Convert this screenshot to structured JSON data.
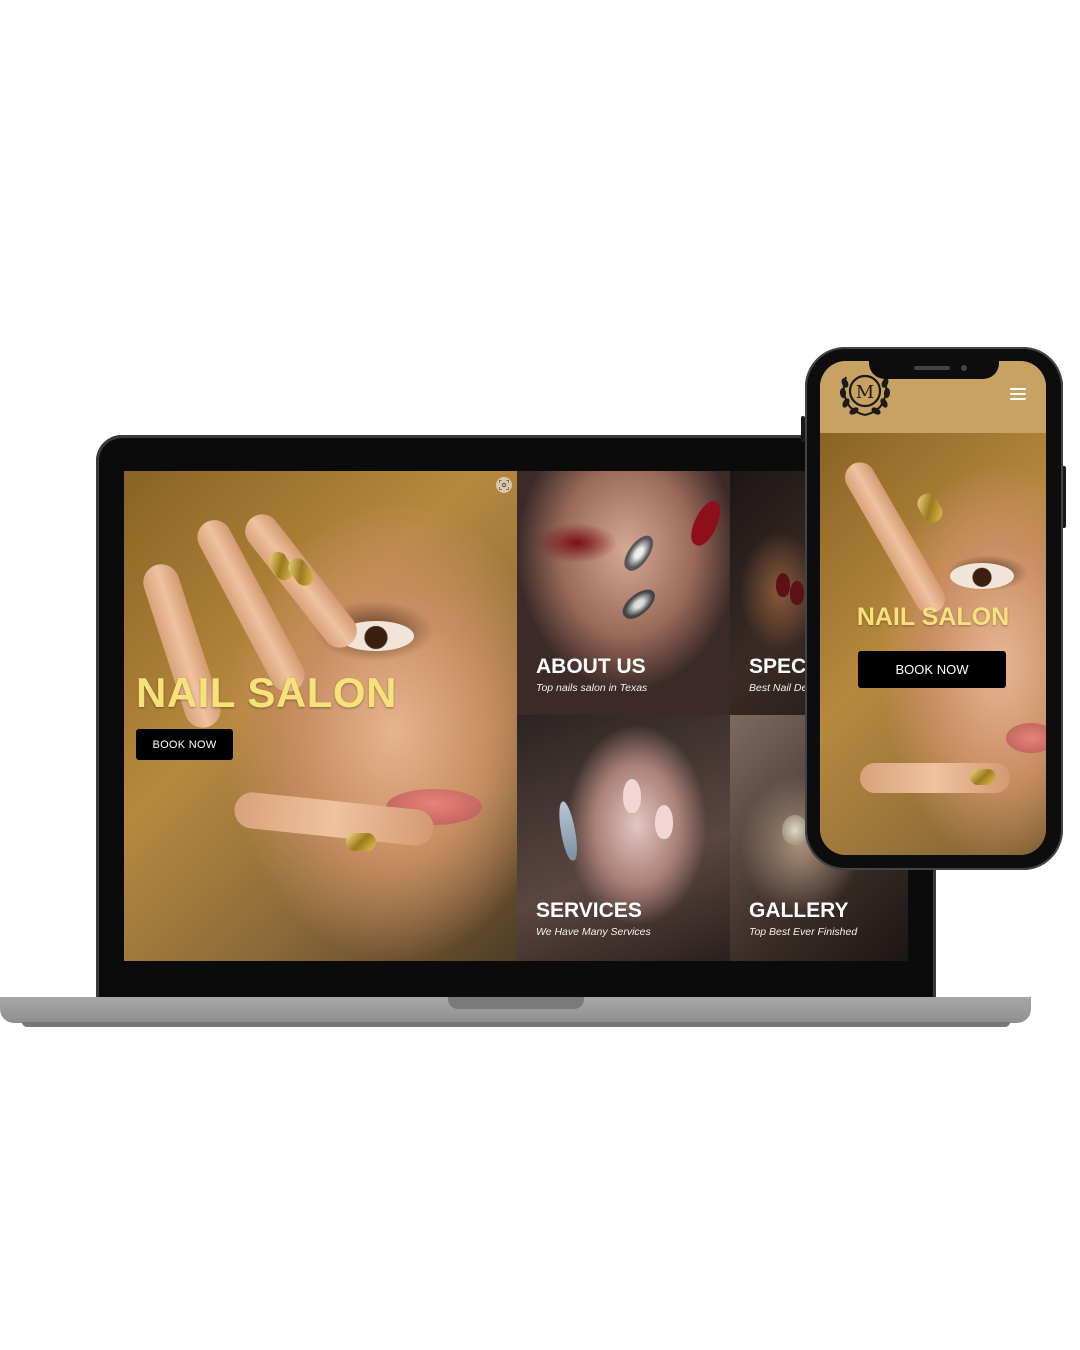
{
  "hero": {
    "title": "NAIL SALON",
    "button_label": "BOOK NOW"
  },
  "tiles": [
    {
      "title": "ABOUT US",
      "subtitle": "Top nails salon in Texas"
    },
    {
      "title": "SPEC",
      "subtitle": "Best Nail De"
    },
    {
      "title": "SERVICES",
      "subtitle": "We Have Many Services"
    },
    {
      "title": "GALLERY",
      "subtitle": "Top Best Ever Finished"
    }
  ],
  "mobile": {
    "logo_letter": "M",
    "title": "NAIL SALON",
    "button_label": "BOOK NOW"
  },
  "icons": {
    "scan": "scan-icon",
    "menu": "hamburger-menu-icon",
    "logo": "laurel-wreath-logo"
  },
  "colors": {
    "title_yellow": "#f7e27a",
    "header_gold": "#c8a263",
    "button_black": "#000000"
  }
}
